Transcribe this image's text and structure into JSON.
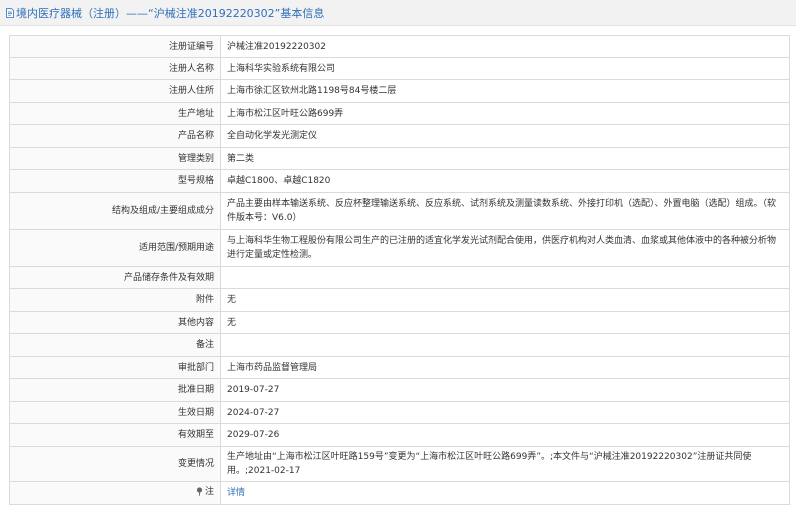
{
  "header": {
    "icon": "document-icon",
    "title": "境内医疗器械（注册）——“沪械注准20192220302”基本信息",
    "accent": "#2f6fb8"
  },
  "rows": [
    {
      "label": "注册证编号",
      "value": "沪械注准20192220302"
    },
    {
      "label": "注册人名称",
      "value": "上海科华实验系统有限公司"
    },
    {
      "label": "注册人住所",
      "value": "上海市徐汇区钦州北路1198号84号楼二层"
    },
    {
      "label": "生产地址",
      "value": "上海市松江区叶旺公路699弄"
    },
    {
      "label": "产品名称",
      "value": "全自动化学发光测定仪"
    },
    {
      "label": "管理类别",
      "value": "第二类"
    },
    {
      "label": "型号规格",
      "value": "卓越C1800、卓越C1820"
    },
    {
      "label": "结构及组成/主要组成成分",
      "value": "产品主要由样本输送系统、反应杯整理输送系统、反应系统、试剂系统及测量读数系统、外接打印机（选配）、外置电脑（选配）组成。（软件版本号：V6.0）"
    },
    {
      "label": "适用范围/预期用途",
      "value": "与上海科华生物工程股份有限公司生产的已注册的适宜化学发光试剂配合使用，供医疗机构对人类血清、血浆或其他体液中的各种被分析物进行定量或定性检测。"
    },
    {
      "label": "产品储存条件及有效期",
      "value": ""
    },
    {
      "label": "附件",
      "value": "无"
    },
    {
      "label": "其他内容",
      "value": "无"
    },
    {
      "label": "备注",
      "value": ""
    },
    {
      "label": "审批部门",
      "value": "上海市药品监督管理局"
    },
    {
      "label": "批准日期",
      "value": "2019-07-27"
    },
    {
      "label": "生效日期",
      "value": "2024-07-27"
    },
    {
      "label": "有效期至",
      "value": "2029-07-26"
    },
    {
      "label": "变更情况",
      "value": "生产地址由“上海市松江区叶旺路159号”变更为“上海市松江区叶旺公路699弄”。;本文件与“沪械注准20192220302”注册证共同使用。;2021-02-17"
    }
  ],
  "remark": {
    "icon": "pin-icon",
    "label": "注",
    "link_text": "详情"
  }
}
